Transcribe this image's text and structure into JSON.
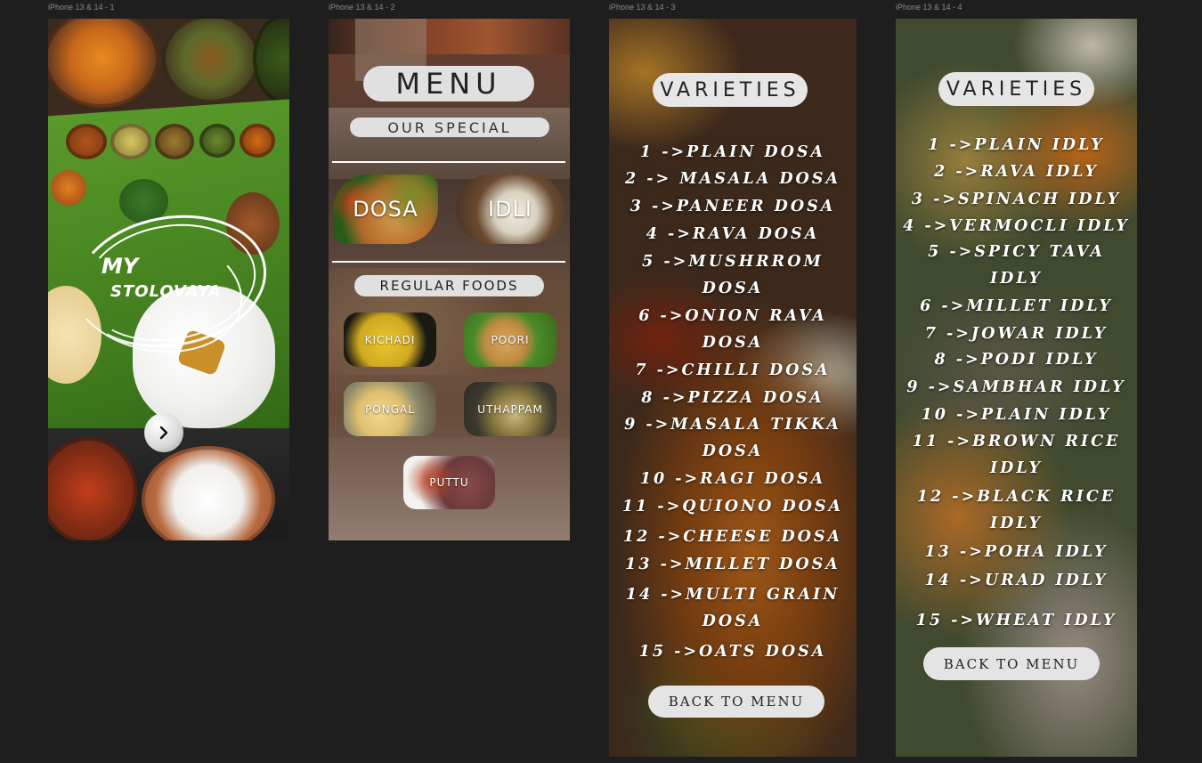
{
  "frames": [
    {
      "label": "iPhone 13 & 14 - 1"
    },
    {
      "label": "iPhone 13 & 14 - 2"
    },
    {
      "label": "iPhone 13 & 14 - 3"
    },
    {
      "label": "iPhone 13 & 14 - 4"
    }
  ],
  "splash": {
    "logo_line1": "MY",
    "logo_line2": "STOLOVAYA",
    "next_icon": "chevron-right-icon"
  },
  "menu": {
    "title": "MENU",
    "special_heading": "OUR SPECIAL",
    "specials": [
      "DOSA",
      "IDLI"
    ],
    "regular_heading": "REGULAR FOODS",
    "regular": [
      "KICHADI",
      "POORI",
      "PONGAL",
      "UTHAPPAM",
      "PUTTU"
    ]
  },
  "dosa": {
    "title": "VARIETIES",
    "items": [
      "1 ->PLAIN DOSA",
      "2 -> MASALA DOSA",
      "3 ->PANEER DOSA",
      "4 ->RAVA DOSA",
      "5 ->MUSHRROM",
      "DOSA",
      "6 ->ONION RAVA",
      "DOSA",
      "7 ->CHILLI DOSA",
      "8 ->PIZZA DOSA",
      "9 ->MASALA TIKKA",
      "DOSA",
      "10 ->RAGI DOSA",
      "11 ->QUIONO DOSA",
      "12 ->CHEESE DOSA",
      "13 ->MILLET DOSA",
      "14 ->MULTI GRAIN",
      "DOSA",
      "15 ->OATS DOSA"
    ],
    "back": "BACK TO MENU"
  },
  "idly": {
    "title": "VARIETIES",
    "items": [
      "1 ->PLAIN IDLY",
      "2 ->RAVA IDLY",
      "3 ->SPINACH IDLY",
      "4 ->VERMOCLI IDLY",
      "5 ->SPICY TAVA",
      "IDLY",
      "6 ->MILLET IDLY",
      "7 ->JOWAR IDLY",
      "8 ->PODI IDLY",
      "9 ->SAMBHAR IDLY",
      "10 ->PLAIN IDLY",
      "11 ->BROWN RICE",
      "IDLY",
      "12 ->BLACK RICE",
      "IDLY",
      "13 ->POHA IDLY",
      "14 ->URAD IDLY",
      "15 ->WHEAT IDLY"
    ],
    "back": "BACK TO MENU"
  },
  "colors": {
    "canvas": "#1e1e1e",
    "pill": "#e0e0e0",
    "leaf": "#4c8a22"
  }
}
